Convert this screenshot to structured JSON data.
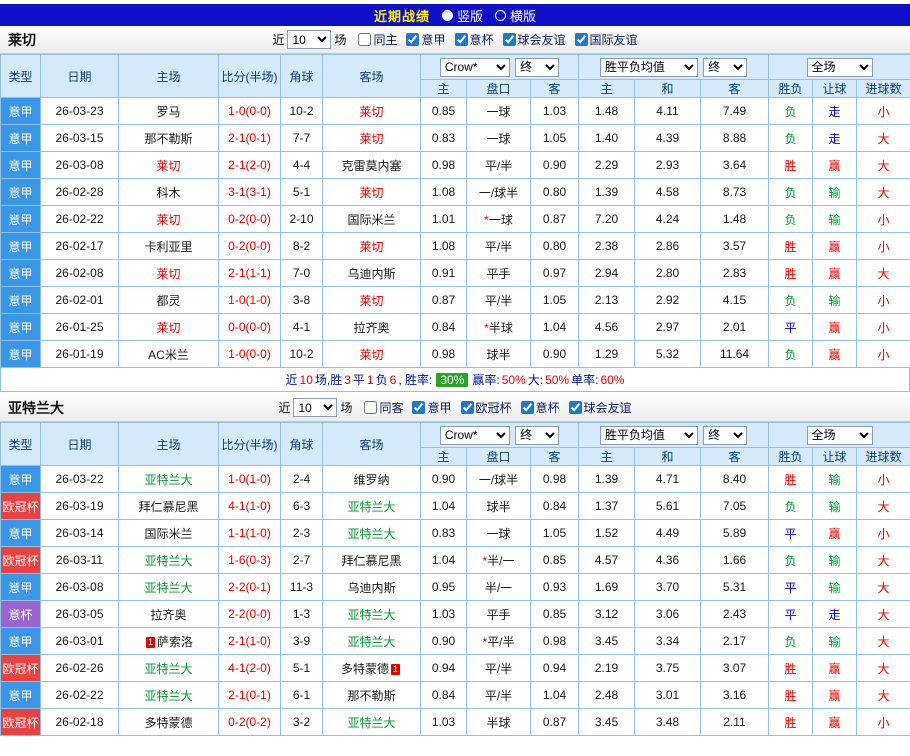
{
  "topbar": {
    "title": "近期战绩",
    "radio_vertical": "竖版",
    "radio_horizontal": "横版"
  },
  "colors": {
    "topbar_blue": "#1010c8",
    "serie_a_blue": "#3a97e8",
    "ucl_red": "#e84343",
    "coppa_purple": "#9a63cf",
    "win_red": "#ee0000",
    "lose_green": "#009933",
    "push_blue": "#0000d0",
    "rate_badge_green": "#2ca12c",
    "table_border_blue": "#94c0e2",
    "header_bg": "#d5ebfb"
  },
  "sections": [
    {
      "team": "莱切",
      "hl": "hl-red",
      "filter": {
        "near_label": "近",
        "count": "10",
        "games_label": "场",
        "checkboxes": [
          {
            "label": "同主",
            "checked": false
          },
          {
            "label": "意甲",
            "checked": true
          },
          {
            "label": "意杯",
            "checked": true
          },
          {
            "label": "球会友谊",
            "checked": true
          },
          {
            "label": "国际友谊",
            "checked": true
          }
        ]
      },
      "header": {
        "col_type": "类型",
        "col_date": "日期",
        "col_home": "主场",
        "col_score": "比分(半场)",
        "col_corner": "角球",
        "col_away": "客场",
        "dd_odds": "Crow*",
        "dd_odds2": "终",
        "dd_euro": "胜平负均值",
        "dd_euro2": "终",
        "dd_scope": "全场",
        "sub": [
          "主",
          "盘口",
          "客",
          "主",
          "和",
          "客",
          "胜负",
          "让球",
          "进球数"
        ]
      },
      "rows": [
        {
          "type": "意甲",
          "tc": "lb",
          "date": "26-03-23",
          "home": {
            "t": "罗马"
          },
          "score": "1-0(0-0)",
          "corner": "10-2",
          "away": {
            "t": "莱切",
            "hl": true
          },
          "o1": "0.85",
          "hc": "一球",
          "o2": "1.03",
          "e1": "1.48",
          "e2": "4.11",
          "e3": "7.49",
          "r1": [
            "负",
            "g"
          ],
          "r2": [
            "走",
            "b"
          ],
          "r3": [
            "小",
            "r"
          ]
        },
        {
          "type": "意甲",
          "tc": "lb",
          "date": "26-03-15",
          "home": {
            "t": "那不勒斯"
          },
          "score": "2-1(0-1)",
          "corner": "7-7",
          "away": {
            "t": "莱切",
            "hl": true
          },
          "o1": "0.83",
          "hc": "一球",
          "o2": "1.05",
          "e1": "1.40",
          "e2": "4.39",
          "e3": "8.88",
          "r1": [
            "负",
            "g"
          ],
          "r2": [
            "走",
            "b"
          ],
          "r3": [
            "大",
            "r"
          ]
        },
        {
          "type": "意甲",
          "tc": "lb",
          "date": "26-03-08",
          "home": {
            "t": "莱切",
            "hl": true
          },
          "score": "2-1(2-0)",
          "corner": "4-4",
          "away": {
            "t": "克雷莫内塞"
          },
          "o1": "0.98",
          "hc": "平/半",
          "o2": "0.90",
          "e1": "2.29",
          "e2": "2.93",
          "e3": "3.64",
          "r1": [
            "胜",
            "r"
          ],
          "r2": [
            "赢",
            "r"
          ],
          "r3": [
            "大",
            "r"
          ]
        },
        {
          "type": "意甲",
          "tc": "lb",
          "date": "26-02-28",
          "home": {
            "t": "科木"
          },
          "score": "3-1(3-1)",
          "corner": "5-1",
          "away": {
            "t": "莱切",
            "hl": true
          },
          "o1": "1.08",
          "hc": "一/球半",
          "o2": "0.80",
          "e1": "1.39",
          "e2": "4.58",
          "e3": "8.73",
          "r1": [
            "负",
            "g"
          ],
          "r2": [
            "输",
            "g"
          ],
          "r3": [
            "大",
            "r"
          ]
        },
        {
          "type": "意甲",
          "tc": "lb",
          "date": "26-02-22",
          "home": {
            "t": "莱切",
            "hl": true
          },
          "score": "0-2(0-0)",
          "corner": "2-10",
          "away": {
            "t": "国际米兰"
          },
          "o1": "1.01",
          "hc": "一球",
          "star": true,
          "o2": "0.87",
          "e1": "7.20",
          "e2": "4.24",
          "e3": "1.48",
          "r1": [
            "负",
            "g"
          ],
          "r2": [
            "输",
            "g"
          ],
          "r3": [
            "小",
            "r"
          ]
        },
        {
          "type": "意甲",
          "tc": "lb",
          "date": "26-02-17",
          "home": {
            "t": "卡利亚里"
          },
          "score": "0-2(0-0)",
          "corner": "8-2",
          "away": {
            "t": "莱切",
            "hl": true
          },
          "o1": "1.08",
          "hc": "平/半",
          "o2": "0.80",
          "e1": "2.38",
          "e2": "2.86",
          "e3": "3.57",
          "r1": [
            "胜",
            "r"
          ],
          "r2": [
            "赢",
            "r"
          ],
          "r3": [
            "小",
            "r"
          ]
        },
        {
          "type": "意甲",
          "tc": "lb",
          "date": "26-02-08",
          "home": {
            "t": "莱切",
            "hl": true
          },
          "score": "2-1(1-1)",
          "corner": "7-0",
          "away": {
            "t": "乌迪内斯"
          },
          "o1": "0.91",
          "hc": "平手",
          "o2": "0.97",
          "e1": "2.94",
          "e2": "2.80",
          "e3": "2.83",
          "r1": [
            "胜",
            "r"
          ],
          "r2": [
            "赢",
            "r"
          ],
          "r3": [
            "大",
            "r"
          ]
        },
        {
          "type": "意甲",
          "tc": "lb",
          "date": "26-02-01",
          "home": {
            "t": "都灵"
          },
          "score": "1-0(1-0)",
          "corner": "3-8",
          "away": {
            "t": "莱切",
            "hl": true
          },
          "o1": "0.87",
          "hc": "平/半",
          "o2": "1.05",
          "e1": "2.13",
          "e2": "2.92",
          "e3": "4.15",
          "r1": [
            "负",
            "g"
          ],
          "r2": [
            "输",
            "g"
          ],
          "r3": [
            "小",
            "r"
          ]
        },
        {
          "type": "意甲",
          "tc": "lb",
          "date": "26-01-25",
          "home": {
            "t": "莱切",
            "hl": true
          },
          "score": "0-0(0-0)",
          "corner": "4-1",
          "away": {
            "t": "拉齐奥"
          },
          "o1": "0.84",
          "hc": "半球",
          "star": true,
          "o2": "1.04",
          "e1": "4.56",
          "e2": "2.97",
          "e3": "2.01",
          "r1": [
            "平",
            "b"
          ],
          "r2": [
            "赢",
            "r"
          ],
          "r3": [
            "小",
            "r"
          ]
        },
        {
          "type": "意甲",
          "tc": "lb",
          "date": "26-01-19",
          "home": {
            "t": "AC米兰"
          },
          "score": "1-0(0-0)",
          "corner": "10-2",
          "away": {
            "t": "莱切",
            "hl": true
          },
          "o1": "0.98",
          "hc": "球半",
          "o2": "0.90",
          "e1": "1.29",
          "e2": "5.32",
          "e3": "11.64",
          "r1": [
            "负",
            "g"
          ],
          "r2": [
            "赢",
            "r"
          ],
          "r3": [
            "小",
            "r"
          ]
        }
      ],
      "footer": [
        {
          "t": "近",
          "c": "n"
        },
        {
          "t": "10",
          "c": "r"
        },
        {
          "t": "场,胜",
          "c": "n"
        },
        {
          "t": "3",
          "c": "r"
        },
        {
          "t": "平",
          "c": "n"
        },
        {
          "t": "1",
          "c": "r"
        },
        {
          "t": "负",
          "c": "n"
        },
        {
          "t": "6",
          "c": "r"
        },
        {
          "t": ", 胜率: ",
          "c": "n"
        },
        {
          "t": "30%",
          "c": "badge"
        },
        {
          "t": " 赢率:",
          "c": "n"
        },
        {
          "t": "50%",
          "c": "r"
        },
        {
          "t": " 大:",
          "c": "n"
        },
        {
          "t": "50%",
          "c": "r"
        },
        {
          "t": " 单率: ",
          "c": "n"
        },
        {
          "t": "60%",
          "c": "r"
        }
      ]
    },
    {
      "team": "亚特兰大",
      "hl": "hl-green",
      "filter": {
        "near_label": "近",
        "count": "10",
        "games_label": "场",
        "checkboxes": [
          {
            "label": "同客",
            "checked": false
          },
          {
            "label": "意甲",
            "checked": true
          },
          {
            "label": "欧冠杯",
            "checked": true
          },
          {
            "label": "意杯",
            "checked": true
          },
          {
            "label": "球会友谊",
            "checked": true
          }
        ]
      },
      "header": {
        "col_type": "类型",
        "col_date": "日期",
        "col_home": "主场",
        "col_score": "比分(半场)",
        "col_corner": "角球",
        "col_away": "客场",
        "dd_odds": "Crow*",
        "dd_odds2": "终",
        "dd_euro": "胜平负均值",
        "dd_euro2": "终",
        "dd_scope": "全场",
        "sub": [
          "主",
          "盘口",
          "客",
          "主",
          "和",
          "客",
          "胜负",
          "让球",
          "进球数"
        ]
      },
      "rows": [
        {
          "type": "意甲",
          "tc": "lb",
          "date": "26-03-22",
          "home": {
            "t": "亚特兰大",
            "hl": true
          },
          "score": "1-0(1-0)",
          "corner": "2-4",
          "away": {
            "t": "维罗纳"
          },
          "o1": "0.90",
          "hc": "一/球半",
          "o2": "0.98",
          "e1": "1.39",
          "e2": "4.71",
          "e3": "8.40",
          "r1": [
            "胜",
            "r"
          ],
          "r2": [
            "输",
            "g"
          ],
          "r3": [
            "小",
            "r"
          ]
        },
        {
          "type": "欧冠杯",
          "tc": "lr",
          "date": "26-03-19",
          "home": {
            "t": "拜仁慕尼黑"
          },
          "score": "4-1(1-0)",
          "corner": "6-3",
          "away": {
            "t": "亚特兰大",
            "hl": true
          },
          "o1": "1.04",
          "hc": "球半",
          "o2": "0.84",
          "e1": "1.37",
          "e2": "5.61",
          "e3": "7.05",
          "r1": [
            "负",
            "g"
          ],
          "r2": [
            "输",
            "g"
          ],
          "r3": [
            "大",
            "r"
          ]
        },
        {
          "type": "意甲",
          "tc": "lb",
          "date": "26-03-14",
          "home": {
            "t": "国际米兰"
          },
          "score": "1-1(1-0)",
          "corner": "2-3",
          "away": {
            "t": "亚特兰大",
            "hl": true
          },
          "o1": "0.83",
          "hc": "一球",
          "o2": "1.05",
          "e1": "1.52",
          "e2": "4.49",
          "e3": "5.89",
          "r1": [
            "平",
            "b"
          ],
          "r2": [
            "赢",
            "r"
          ],
          "r3": [
            "小",
            "r"
          ]
        },
        {
          "type": "欧冠杯",
          "tc": "lr",
          "date": "26-03-11",
          "home": {
            "t": "亚特兰大",
            "hl": true
          },
          "score": "1-6(0-3)",
          "corner": "2-7",
          "away": {
            "t": "拜仁慕尼黑"
          },
          "o1": "1.04",
          "hc": "半/一",
          "star": true,
          "o2": "0.85",
          "e1": "4.57",
          "e2": "4.36",
          "e3": "1.66",
          "r1": [
            "负",
            "g"
          ],
          "r2": [
            "输",
            "g"
          ],
          "r3": [
            "大",
            "r"
          ]
        },
        {
          "type": "意甲",
          "tc": "lb",
          "date": "26-03-08",
          "home": {
            "t": "亚特兰大",
            "hl": true
          },
          "score": "2-2(0-1)",
          "corner": "11-3",
          "away": {
            "t": "乌迪内斯"
          },
          "o1": "0.95",
          "hc": "半/一",
          "o2": "0.93",
          "e1": "1.69",
          "e2": "3.70",
          "e3": "5.31",
          "r1": [
            "平",
            "b"
          ],
          "r2": [
            "输",
            "g"
          ],
          "r3": [
            "大",
            "r"
          ]
        },
        {
          "type": "意杯",
          "tc": "lp",
          "date": "26-03-05",
          "home": {
            "t": "拉齐奥"
          },
          "score": "2-2(0-0)",
          "corner": "1-3",
          "away": {
            "t": "亚特兰大",
            "hl": true
          },
          "o1": "1.03",
          "hc": "平手",
          "o2": "0.85",
          "e1": "3.12",
          "e2": "3.06",
          "e3": "2.43",
          "r1": [
            "平",
            "b"
          ],
          "r2": [
            "走",
            "b"
          ],
          "r3": [
            "大",
            "r"
          ]
        },
        {
          "type": "意甲",
          "tc": "lb",
          "date": "26-03-01",
          "home": {
            "t": "萨索洛",
            "card": "before",
            "card_n": "1"
          },
          "score": "2-1(1-0)",
          "corner": "3-9",
          "away": {
            "t": "亚特兰大",
            "hl": true
          },
          "o1": "0.90",
          "hc": "平/半",
          "star": true,
          "o2": "0.98",
          "e1": "3.45",
          "e2": "3.34",
          "e3": "2.17",
          "r1": [
            "负",
            "g"
          ],
          "r2": [
            "输",
            "g"
          ],
          "r3": [
            "大",
            "r"
          ]
        },
        {
          "type": "欧冠杯",
          "tc": "lr",
          "date": "26-02-26",
          "home": {
            "t": "亚特兰大",
            "hl": true
          },
          "score": "4-1(2-0)",
          "corner": "5-1",
          "away": {
            "t": "多特蒙德",
            "card": "after",
            "card_n": "1"
          },
          "o1": "0.94",
          "hc": "平/半",
          "o2": "0.94",
          "e1": "2.19",
          "e2": "3.75",
          "e3": "3.07",
          "r1": [
            "胜",
            "r"
          ],
          "r2": [
            "赢",
            "r"
          ],
          "r3": [
            "大",
            "r"
          ]
        },
        {
          "type": "意甲",
          "tc": "lb",
          "date": "26-02-22",
          "home": {
            "t": "亚特兰大",
            "hl": true
          },
          "score": "2-1(0-1)",
          "corner": "6-1",
          "away": {
            "t": "那不勒斯"
          },
          "o1": "0.84",
          "hc": "平/半",
          "o2": "1.04",
          "e1": "2.48",
          "e2": "3.01",
          "e3": "3.16",
          "r1": [
            "胜",
            "r"
          ],
          "r2": [
            "赢",
            "r"
          ],
          "r3": [
            "大",
            "r"
          ]
        },
        {
          "type": "欧冠杯",
          "tc": "lr",
          "date": "26-02-18",
          "home": {
            "t": "多特蒙德"
          },
          "score": "0-2(0-2)",
          "corner": "3-2",
          "away": {
            "t": "亚特兰大",
            "hl": true
          },
          "o1": "1.03",
          "hc": "半球",
          "o2": "0.87",
          "e1": "3.45",
          "e2": "3.48",
          "e3": "2.11",
          "r1": [
            "胜",
            "r"
          ],
          "r2": [
            "赢",
            "r"
          ],
          "r3": [
            "小",
            "r"
          ]
        }
      ]
    }
  ]
}
